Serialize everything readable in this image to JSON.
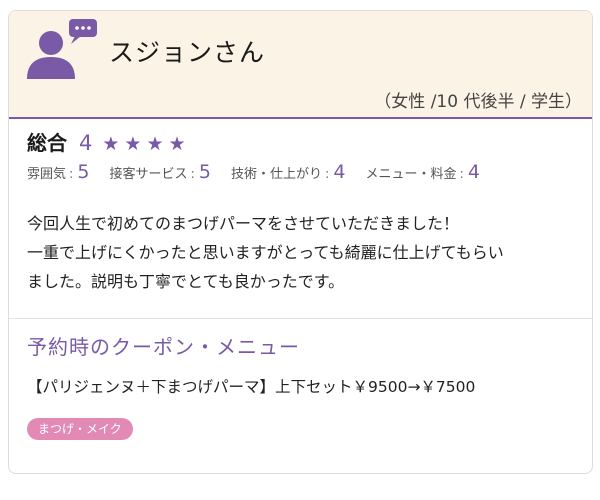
{
  "review": {
    "reviewer_name": "スジョンさん",
    "profile": "（女性 /10 代後半 / 学生）",
    "overall": {
      "label": "総合",
      "score": "4",
      "stars": 4
    },
    "sub_ratings": [
      {
        "label": "雰囲気",
        "sep": ":",
        "value": "5"
      },
      {
        "label": "接客サービス",
        "sep": ":",
        "value": "5"
      },
      {
        "label": "技術・仕上がり",
        "sep": ":",
        "value": "4"
      },
      {
        "label": "メニュー・料金",
        "sep": ":",
        "value": "4"
      }
    ],
    "comment_lines": [
      "今回人生で初めてのまつげパーマをさせていただきました！",
      "一重で上げにくかったと思いますがとっても綺麗に仕上げてもらい",
      "ました。説明も丁寧でとても良かったです。"
    ],
    "coupon": {
      "title": "予約時のクーポン・メニュー",
      "item": "【パリジェンヌ＋下まつげパーマ】上下セット￥9500→￥7500",
      "tag": "まつげ・メイク"
    }
  },
  "colors": {
    "accent": "#7a5aa6",
    "header_bg": "#fbf3e5",
    "tag_bg": "#e28ab4"
  },
  "icons": {
    "avatar": "person-speech-bubble-icon",
    "star": "star-icon"
  }
}
